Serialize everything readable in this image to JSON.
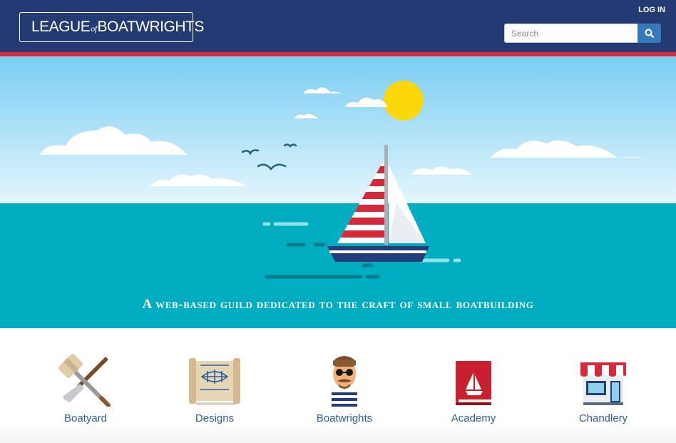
{
  "header": {
    "logo": {
      "prefix": "LEAGUE",
      "of": "of",
      "suffix": "BOATWRIGHTS"
    },
    "login_label": "LOG IN",
    "search": {
      "placeholder": "Search"
    }
  },
  "hero": {
    "tagline": "A web-based guild dedicated to the craft of small boatbuilding",
    "colors": {
      "sky": "#7cd0f4",
      "sea": "#00adc0",
      "sun": "#fcd80a",
      "sail_stripe": "#d8283a",
      "hull": "#243c7a"
    }
  },
  "nav": {
    "items": [
      {
        "label": "Boatyard",
        "icon": "mallet-chisel-icon"
      },
      {
        "label": "Designs",
        "icon": "blueprint-scroll-icon"
      },
      {
        "label": "Boatwrights",
        "icon": "sailor-avatar-icon"
      },
      {
        "label": "Academy",
        "icon": "book-icon"
      },
      {
        "label": "Chandlery",
        "icon": "shop-icon"
      }
    ]
  },
  "colors": {
    "header": "#233a72",
    "accent_red": "#d8283a",
    "link": "#2d5ea0",
    "search_button": "#3879bb"
  }
}
